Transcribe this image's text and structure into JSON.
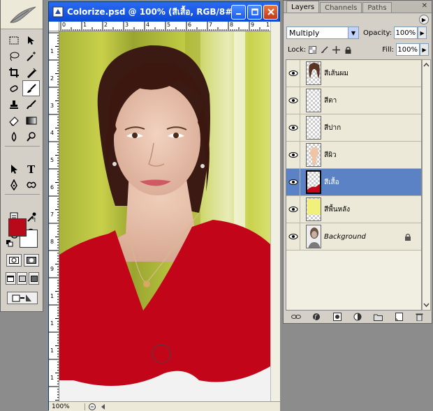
{
  "document": {
    "title": "Colorize.psd @ 100% (สีเสื้อ, RGB/8#)",
    "zoom": "100%",
    "ruler_top_labels": [
      "0",
      "1",
      "2",
      "3",
      "4",
      "5",
      "6",
      "7",
      "8",
      "9",
      "1"
    ],
    "ruler_left_labels": [
      "1",
      "2",
      "3",
      "4",
      "5",
      "6",
      "7",
      "8",
      "9",
      "1",
      "1",
      "1",
      "1"
    ]
  },
  "colors": {
    "foreground": "#b8091a",
    "background": "#ffffff",
    "selection": "#5a82c4"
  },
  "layers_panel": {
    "tabs": [
      "Layers",
      "Channels",
      "Paths"
    ],
    "active_tab": "Layers",
    "blend_mode": "Multiply",
    "opacity_label": "Opacity:",
    "opacity_value": "100%",
    "lock_label": "Lock:",
    "fill_label": "Fill:",
    "fill_value": "100%",
    "layers": [
      {
        "name": "สีเส้นผม",
        "thumb": "hair"
      },
      {
        "name": "สีตา",
        "thumb": "empty"
      },
      {
        "name": "สีปาก",
        "thumb": "empty"
      },
      {
        "name": "สีผิว",
        "thumb": "skin"
      },
      {
        "name": "สีเสื้อ",
        "thumb": "shirt",
        "selected": true
      },
      {
        "name": "สีพื้นหลัง",
        "thumb": "bgcolor"
      },
      {
        "name": "Background",
        "thumb": "photo",
        "locked": true
      }
    ]
  },
  "icons": {
    "tools": [
      "marquee-icon",
      "move-icon",
      "lasso-icon",
      "magic-wand-icon",
      "crop-icon",
      "slice-icon",
      "healing-icon",
      "brush-icon",
      "stamp-icon",
      "history-brush-icon",
      "eraser-icon",
      "gradient-icon",
      "blur-icon",
      "dodge-icon",
      "path-select-icon",
      "type-icon",
      "pen-icon",
      "shape-icon",
      "notes-icon",
      "eyedropper-icon",
      "hand-icon",
      "zoom-icon"
    ]
  }
}
